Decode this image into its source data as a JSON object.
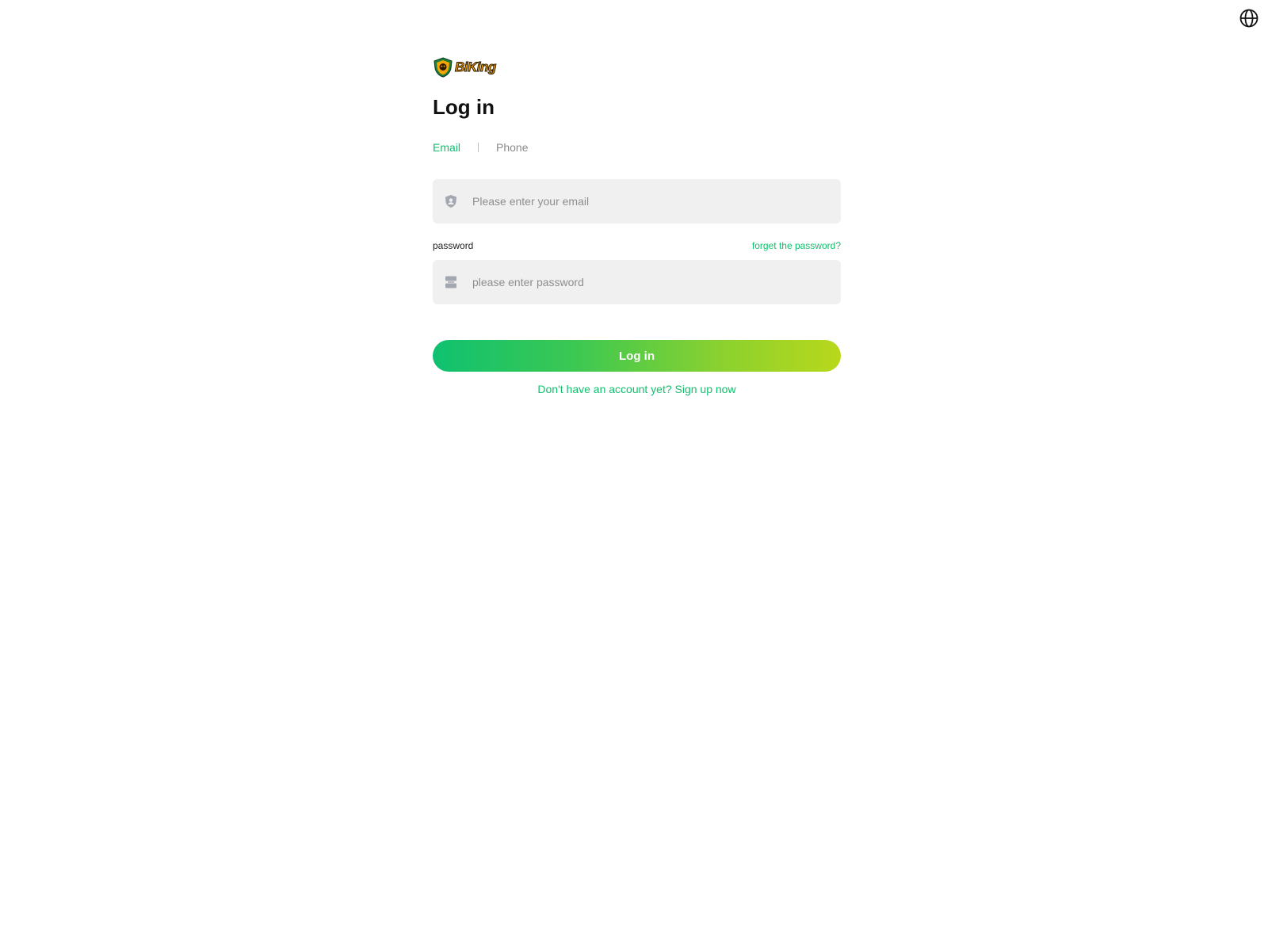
{
  "header": {
    "language_icon": "globe-icon"
  },
  "brand": {
    "name": "BiKing",
    "logo_icon": "shield-logo-icon",
    "colors": {
      "shield": "#1a7f3c",
      "text": "#f5a300"
    }
  },
  "login": {
    "title": "Log in",
    "tabs": [
      {
        "label": "Email",
        "active": true
      },
      {
        "label": "Phone",
        "active": false
      }
    ],
    "email_field": {
      "icon": "user-shield-icon",
      "value": "",
      "placeholder": "Please enter your email"
    },
    "password_label": "password",
    "forgot_label": "forget the password?",
    "password_field": {
      "icon": "lock-icon",
      "value": "",
      "placeholder": "please enter password"
    },
    "submit_label": "Log in",
    "signup_prompt": "Don't have an account yet? Sign up now"
  },
  "colors": {
    "accent": "#12bf6e",
    "button_gradient_start": "#0fc170",
    "button_gradient_end": "#b8d81b",
    "input_bg": "#f0f0f0"
  }
}
